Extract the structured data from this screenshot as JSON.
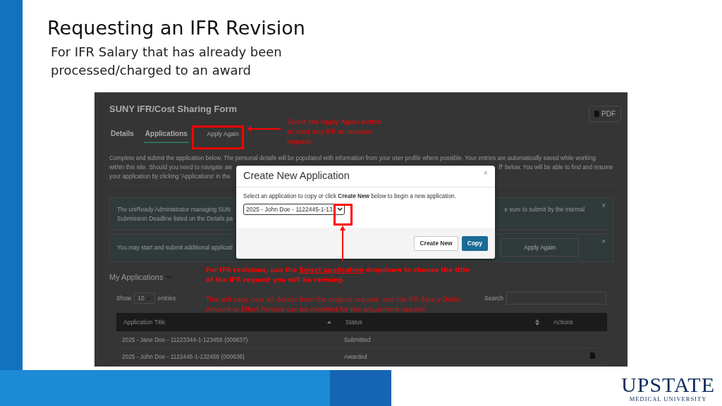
{
  "slide": {
    "title": "Requesting an IFR Revision",
    "subtitle_lines": [
      "For IFR Salary that has already been",
      "processed/charged to an award"
    ]
  },
  "form": {
    "title": "SUNY IFR/Cost Sharing Form",
    "pdf_button": "PDF",
    "tabs": [
      {
        "label": "Details",
        "kind": "tab",
        "selected": false
      },
      {
        "label": "Applications",
        "kind": "tab",
        "selected": true
      },
      {
        "label": "Apply Again",
        "kind": "button",
        "selected": false
      }
    ],
    "intro": [
      {
        "left": "Complete and submit the application below. The personal details will be populated with information from your user profile where possible. Your entries are automatically saved while working"
      },
      {
        "left": "within this site. Should you need to navigate aw",
        "right": "ff' below. You will be able to find and resume"
      },
      {
        "left": "your application by clicking 'Applications' in the"
      }
    ],
    "alerts": [
      {
        "lines": [
          {
            "left": "The uniReady Administrator managing SUN",
            "right": "e sure to submit by the internal"
          },
          {
            "left": "Submission Deadline listed on the Details pa"
          }
        ],
        "close": "×"
      },
      {
        "lines": [
          {
            "left": "You may start and submit additional applicati"
          }
        ],
        "button": "Apply Again",
        "close": "×"
      }
    ],
    "section_title": "My Applications",
    "show_label": "Show",
    "page_size": "10",
    "entries_label": "entries",
    "search_label": "Search",
    "table": {
      "columns": [
        {
          "label": "Application Title",
          "sortable": true,
          "ascending": true
        },
        {
          "label": "Status",
          "sortable": true,
          "ascending": false
        },
        {
          "label": "Actions",
          "sortable": false
        }
      ],
      "rows": [
        {
          "title": "2025 - Jane Doe - 11223344-1-123456 (000637)",
          "status": "Submitted",
          "action_icon": false
        },
        {
          "title": "2025 - John Doe - 1122445-1-132456 (000636)",
          "status": "Awarded",
          "action_icon": true
        }
      ]
    }
  },
  "modal": {
    "title": "Create New Application",
    "close": "×",
    "instruction": "Select an application to copy or click **Create New** below to begin a new application.",
    "selected_value": "2025 - John Doe - 1122445-1-13",
    "buttons": [
      {
        "label": "Create New",
        "primary": false
      },
      {
        "label": "Copy",
        "primary": true
      }
    ]
  },
  "annotations": {
    "top": [
      "Select the Apply Again button",
      "to start any IFR or revision",
      "request"
    ],
    "bottom_bold": [
      {
        "before": "For IFR revisions, use the ",
        "underlined": "Select application",
        "after": " dropdown to choose the title"
      },
      {
        "before": "of the IFR request you will be revising."
      }
    ],
    "bottom_plain": [
      "This will copy over all details from the original request, and the IFR Salary Dollar",
      "Amount or Effort Percent can be modified for the adjustment needed"
    ]
  },
  "logo": {
    "name": "UPSTATE",
    "subtitle": "MEDICAL UNIVERSITY"
  }
}
